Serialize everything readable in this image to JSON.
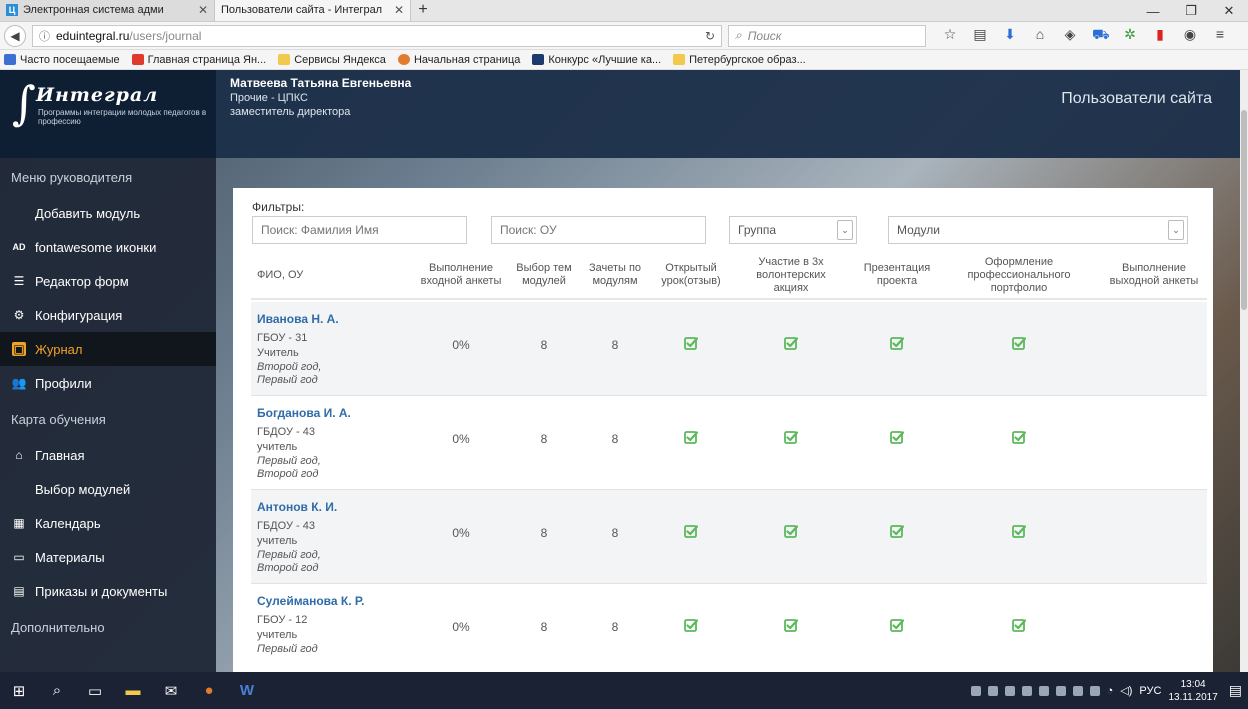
{
  "browser": {
    "tabs": [
      {
        "title": "Электронная система адми",
        "active": false
      },
      {
        "title": "Пользователи сайта - Интеграл",
        "active": true
      }
    ],
    "url_host": "eduintegral.ru",
    "url_path": "/users/journal",
    "search_placeholder": "Поиск",
    "bookmarks": [
      {
        "label": "Часто посещаемые",
        "color": "#3c6fd1"
      },
      {
        "label": "Главная страница Ян...",
        "color": "#e03a2e"
      },
      {
        "label": "Сервисы Яндекса",
        "color": "#f2c94c"
      },
      {
        "label": "Начальная страница",
        "color": "#e27b2c"
      },
      {
        "label": "Конкурс «Лучшие ка...",
        "color": "#1d3a6e"
      },
      {
        "label": "Петербургское образ...",
        "color": "#f2c94c"
      }
    ]
  },
  "header": {
    "logo_name": "Интеграл",
    "logo_tagline": "Программы интеграции молодых педагогов в профессию",
    "user_name": "Матвеева Татьяна Евгеньевна",
    "user_org": "Прочие - ЦПКС",
    "user_role": "заместитель директора",
    "page_title": "Пользователи сайта"
  },
  "sidebar": {
    "section_manager": "Меню руководителя",
    "manager_items": [
      {
        "label": "Добавить модуль",
        "icon": "grid-icon"
      },
      {
        "label": "fontawesome иконки",
        "icon": "adobe-icon"
      },
      {
        "label": "Редактор форм",
        "icon": "list-icon"
      },
      {
        "label": "Конфигурация",
        "icon": "gears-icon"
      },
      {
        "label": "Журнал",
        "icon": "journal-icon",
        "active": true
      },
      {
        "label": "Профили",
        "icon": "users-icon"
      }
    ],
    "section_learning": "Карта обучения",
    "learning_items": [
      {
        "label": "Главная",
        "icon": "home-icon"
      },
      {
        "label": "Выбор модулей",
        "icon": "grid-icon"
      },
      {
        "label": "Календарь",
        "icon": "calendar-icon"
      },
      {
        "label": "Материалы",
        "icon": "folder-icon"
      },
      {
        "label": "Приказы и документы",
        "icon": "document-icon"
      }
    ],
    "section_extra": "Дополнительно",
    "accent_color": "#f0a329"
  },
  "filters": {
    "label": "Фильтры:",
    "name_placeholder": "Поиск: Фамилия Имя",
    "org_placeholder": "Поиск: ОУ",
    "group_value": "Группа",
    "modules_value": "Модули"
  },
  "table": {
    "columns": [
      "ФИО, ОУ",
      "Выполнение входной анкеты",
      "Выбор тем модулей",
      "Зачеты по модулям",
      "Открытый урок(отзыв)",
      "Участие в 3х волонтерских акциях",
      "Презентация проекта",
      "Оформление профессионального портфолио",
      "Выполнение выходной анкеты"
    ],
    "rows": [
      {
        "name": "Иванова Н. А.",
        "org": "ГБОУ - 31",
        "role": "Учитель",
        "years": [
          "Второй год,",
          "Первый год"
        ],
        "entry_survey": "0%",
        "topics": "8",
        "credits": "8",
        "lesson": true,
        "volunteer": true,
        "presentation": true,
        "portfolio": true
      },
      {
        "name": "Богданова И. А.",
        "org": "ГБДОУ - 43",
        "role": "учитель",
        "years": [
          "Первый год,",
          "Второй год"
        ],
        "entry_survey": "0%",
        "topics": "8",
        "credits": "8",
        "lesson": true,
        "volunteer": true,
        "presentation": true,
        "portfolio": true
      },
      {
        "name": "Антонов К. И.",
        "org": "ГБДОУ - 43",
        "role": "учитель",
        "years": [
          "Первый год,",
          "Второй год"
        ],
        "entry_survey": "0%",
        "topics": "8",
        "credits": "8",
        "lesson": true,
        "volunteer": true,
        "presentation": true,
        "portfolio": true
      },
      {
        "name": "Сулейманова К. Р.",
        "org": "ГБОУ - 12",
        "role": "учитель",
        "years": [
          "Первый год"
        ],
        "entry_survey": "0%",
        "topics": "8",
        "credits": "8",
        "lesson": true,
        "volunteer": true,
        "presentation": true,
        "portfolio": true
      }
    ],
    "check_color": "#5cb85c"
  },
  "taskbar": {
    "lang": "РУС",
    "time": "13:04",
    "date": "13.11.2017"
  }
}
